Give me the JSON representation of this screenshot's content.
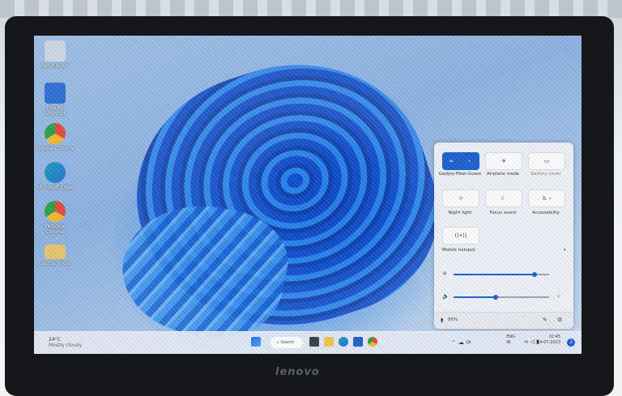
{
  "desktop": {
    "icons": [
      {
        "label": "Recycle Bin",
        "color": "#cfd8e3"
      },
      {
        "label": "This PC Shortcut",
        "color": "#2f6fd4"
      },
      {
        "label": "Google Chrome",
        "color": "#e24a3b"
      },
      {
        "label": "Microsoft Edge",
        "color": "#16a0b8"
      },
      {
        "label": "Personal Chrome",
        "color": "#f2b632"
      },
      {
        "label": "Laptop folder",
        "color": "#e8c56a"
      }
    ]
  },
  "taskbar": {
    "weather_temp": "24°C",
    "weather_text": "Mostly cloudy",
    "search_label": "Search",
    "language_line1": "ENG",
    "language_line2": "IN",
    "time": "10:45",
    "date": "24-07-2023",
    "notification_count": "1"
  },
  "quick_settings": {
    "tiles": [
      {
        "label": "Gadjoy-Fiber-Guest",
        "icon": "wifi-icon",
        "active": true
      },
      {
        "label": "Airplane mode",
        "icon": "airplane-icon",
        "active": false
      },
      {
        "label": "Battery saver",
        "icon": "battery-icon",
        "active": false
      },
      {
        "label": "Night light",
        "icon": "sun-icon",
        "active": false
      },
      {
        "label": "Focus assist",
        "icon": "moon-icon",
        "active": false
      },
      {
        "label": "Accessibility",
        "icon": "accessibility-icon",
        "active": false
      },
      {
        "label": "",
        "icon": "hotspot-icon",
        "active": false
      }
    ],
    "hotspot_label": "Mobile hotspot",
    "brightness": 0.85,
    "volume": 0.44,
    "battery": "95%"
  },
  "laptop_brand": "lenovo"
}
